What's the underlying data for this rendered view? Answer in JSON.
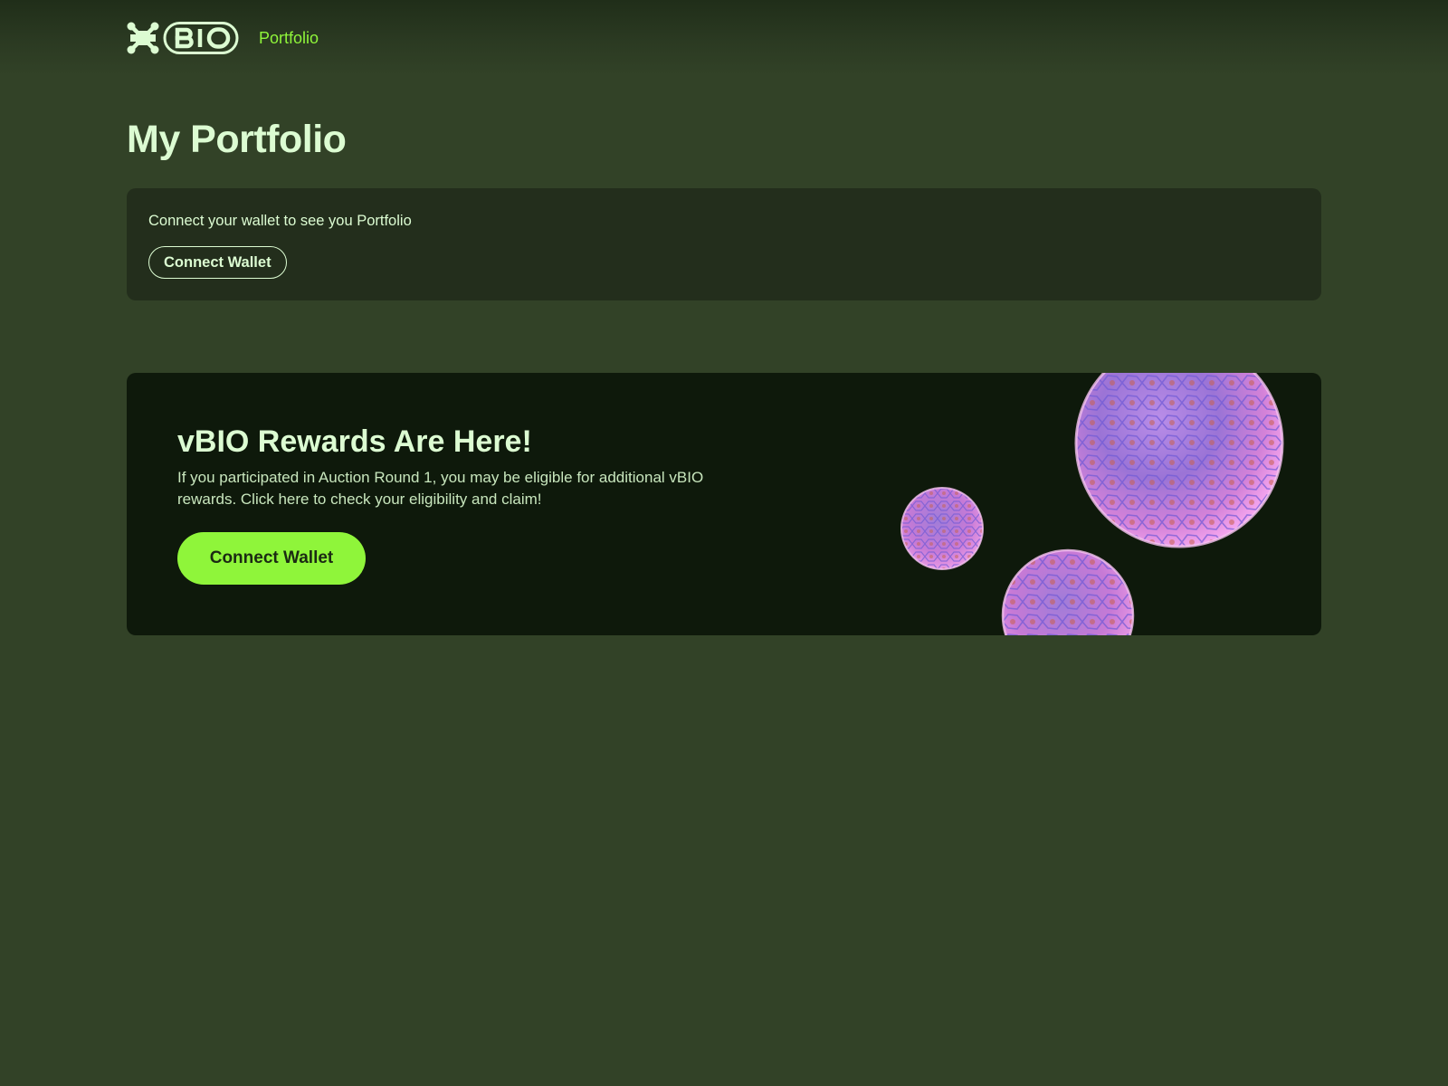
{
  "brand": {
    "name": "BIO"
  },
  "nav": {
    "portfolio_label": "Portfolio"
  },
  "page": {
    "title": "My Portfolio"
  },
  "wallet_card": {
    "message": "Connect your wallet to see you Portfolio",
    "button_label": "Connect Wallet"
  },
  "rewards_banner": {
    "headline": "vBIO Rewards Are Here!",
    "description": "If you participated in Auction Round 1, you may be eligible for additional vBIO rewards. Click here to check your eligibility and claim!",
    "button_label": "Connect Wallet"
  },
  "colors": {
    "background": "#324227",
    "card": "#232e1c",
    "banner": "#0e190b",
    "accent": "#8ff53a",
    "text": "#dcfcd2",
    "orb": "#d786e6"
  },
  "icons": {
    "logo_mark": "molecule-icon",
    "banner_art": "cell-spheres"
  }
}
